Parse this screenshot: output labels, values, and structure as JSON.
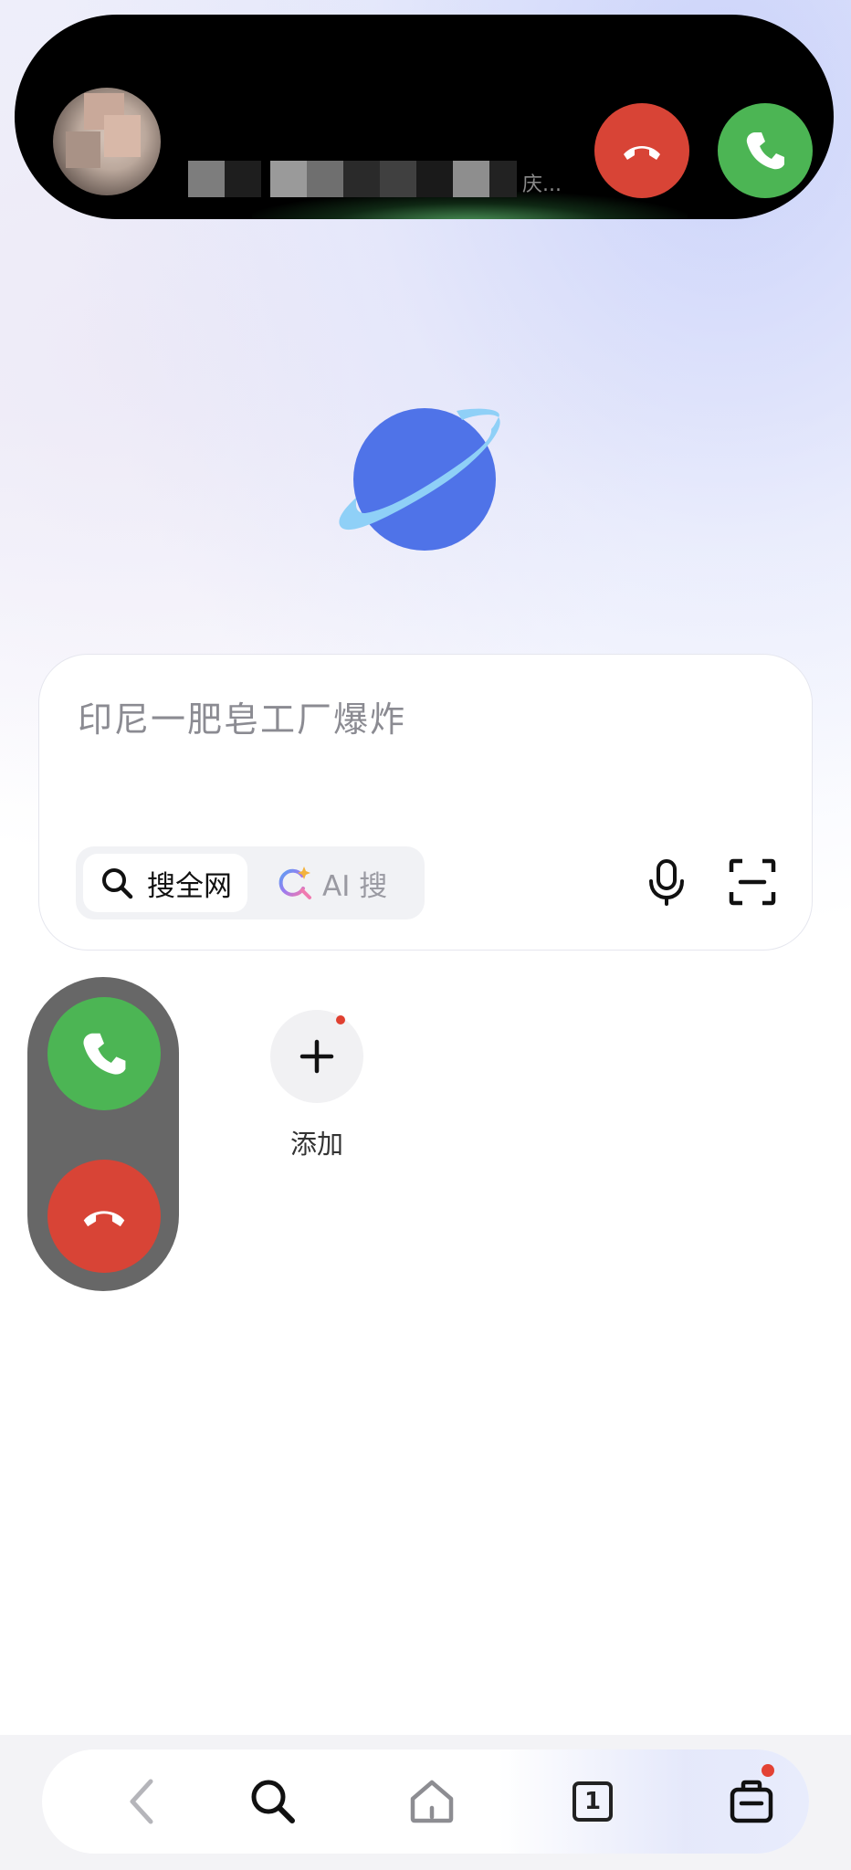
{
  "incoming_call": {
    "caller_suffix": "庆..."
  },
  "search": {
    "query_text": "印尼一肥皂工厂爆炸",
    "mode_all_label": "搜全网",
    "mode_ai_label": "AI 搜"
  },
  "shortcuts": {
    "add_label": "添加"
  },
  "bottom_nav": {
    "tabs_count": "1"
  },
  "colors": {
    "accept_green": "#4cb554",
    "decline_red": "#d84436",
    "planet_blue": "#4f73e8",
    "ring_light_blue": "#8fd0f7",
    "notification_red": "#e34234"
  },
  "icons": {
    "banner_decline": "phone-hangup-icon",
    "banner_accept": "phone-icon",
    "search": "search-icon",
    "ai_search": "ai-sparkle-search-icon",
    "mic": "microphone-icon",
    "scan": "scan-icon",
    "add": "plus-icon",
    "back": "chevron-left-icon",
    "home": "home-icon",
    "tabs": "tabs-icon",
    "me": "briefcase-icon"
  }
}
